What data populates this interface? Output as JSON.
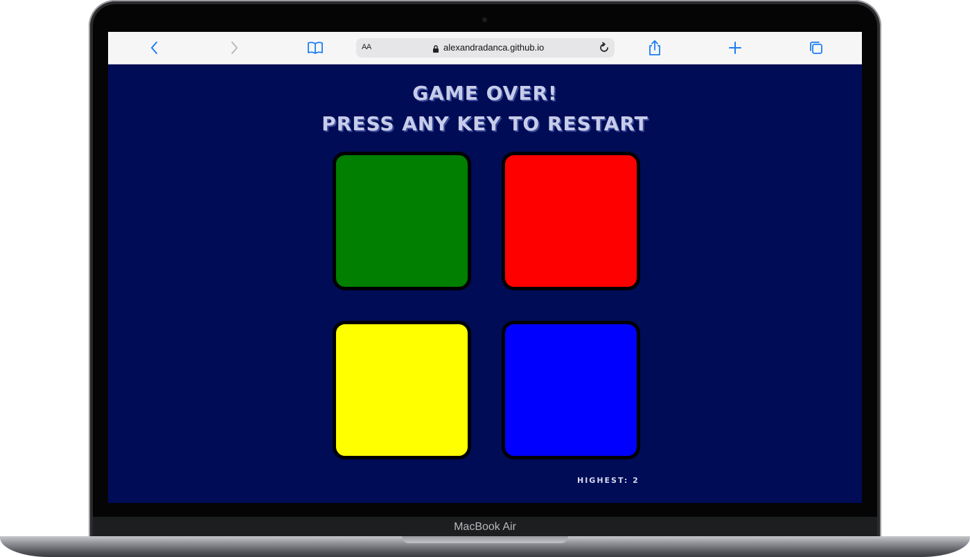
{
  "browser": {
    "url": "alexandradanca.github.io",
    "reader_label": "AA",
    "accent_color": "#1a7cf5"
  },
  "game": {
    "title_line1": "GAME OVER!",
    "title_line2": "PRESS ANY KEY TO RESTART",
    "background_color": "#000c56",
    "pads": [
      {
        "name": "green",
        "color": "#007f00"
      },
      {
        "name": "red",
        "color": "#ff0000"
      },
      {
        "name": "yellow",
        "color": "#ffff00"
      },
      {
        "name": "blue",
        "color": "#0000ff"
      }
    ],
    "highest_label": "HIGHEST: 2"
  },
  "device": {
    "label": "MacBook Air"
  }
}
